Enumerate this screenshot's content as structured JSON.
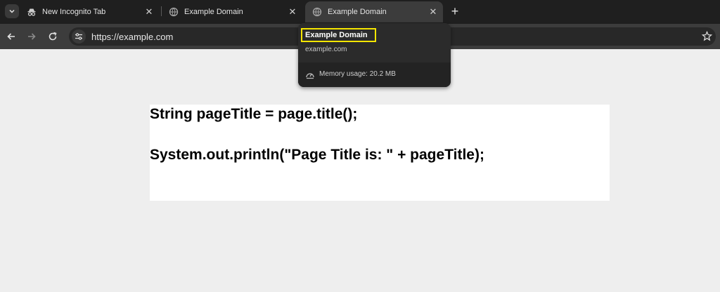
{
  "tabs": [
    {
      "label": "New Incognito Tab",
      "icon": "incognito-icon",
      "close": "✕"
    },
    {
      "label": "Example Domain",
      "icon": "globe-icon",
      "close": "✕"
    },
    {
      "label": "Example Domain",
      "icon": "globe-icon",
      "close": "✕",
      "active": true
    }
  ],
  "new_tab_label": "+",
  "address_bar": {
    "url": "https://example.com"
  },
  "hovercard": {
    "title": "Example Domain",
    "domain": "example.com",
    "memory": "Memory usage: 20.2 MB",
    "highlight_color": "#f5e600"
  },
  "page": {
    "lines": [
      "String pageTitle = page.title();",
      "System.out.println(\"Page Title is: \" + pageTitle);"
    ]
  }
}
